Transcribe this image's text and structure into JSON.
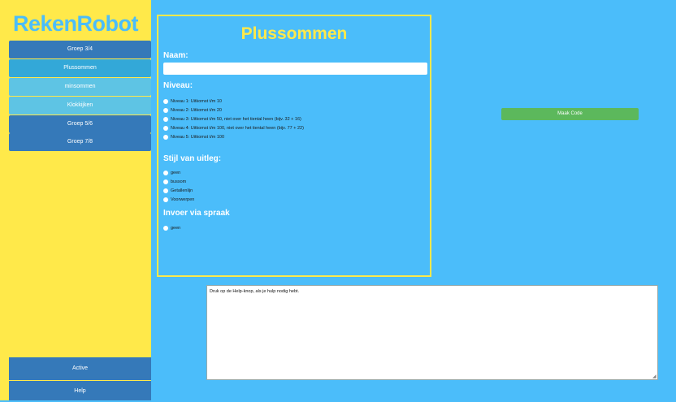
{
  "app": {
    "logo": "RekenRobot"
  },
  "sidebar": {
    "items": [
      {
        "label": "Groep 3/4"
      },
      {
        "label": "Plussommen"
      },
      {
        "label": "minsommen"
      },
      {
        "label": "Klokkijken"
      },
      {
        "label": "Groep 5/6"
      },
      {
        "label": "Groep 7/8"
      }
    ],
    "active_label": "Active",
    "help_label": "Help"
  },
  "form": {
    "title": "Plussommen",
    "name_label": "Naam:",
    "name_value": "",
    "level_label": "Niveau:",
    "levels": [
      "Niveau 1: Uitkomst t/m 10",
      "Niveau 2: Uitkomst t/m 20",
      "Niveau 3: Uitkomst t/m 50, niet over het tiental heen (bijv. 32 + 16)",
      "Niveau 4: Uitkomst t/m 100, niet over het tiental heen (bijv. 77 + 22)",
      "Niveau 5: Uitkomst t/m 100"
    ],
    "style_label": "Stijl van uitleg:",
    "styles": [
      "geen",
      "bussom",
      "Getallenlijn",
      "Voorwerpen"
    ],
    "speech_label": "Invoer via spraak",
    "speech_options": [
      "geen"
    ]
  },
  "actions": {
    "make_code_label": "Maak Code"
  },
  "help": {
    "text": "Druk op de Help-knop, als je hulp nodig hebt."
  }
}
